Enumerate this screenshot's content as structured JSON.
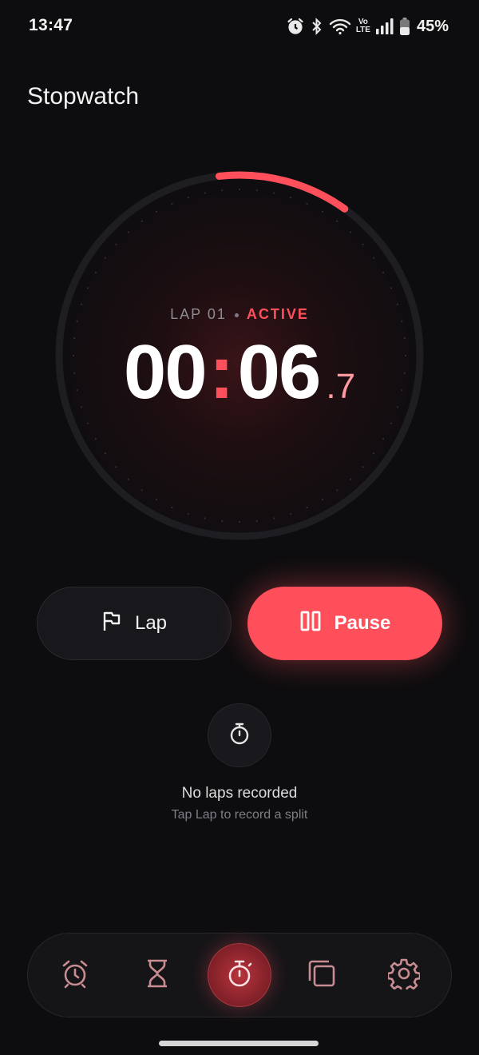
{
  "status_bar": {
    "time": "13:47",
    "volte_top": "Vo",
    "volte_bottom": "LTE",
    "battery_percent": "45%",
    "icons": [
      "alarm-icon",
      "bluetooth-icon",
      "wifi-icon",
      "volte-icon",
      "signal-icon",
      "battery-icon"
    ]
  },
  "header": {
    "title": "Stopwatch"
  },
  "stopwatch": {
    "lap_label": "LAP 01",
    "state_label": "ACTIVE",
    "minutes": "00",
    "separator": ":",
    "seconds": "06",
    "tenths": ".7",
    "progress_fraction": 0.117
  },
  "actions": {
    "lap_label": "Lap",
    "pause_label": "Pause"
  },
  "laps": {
    "empty_title": "No laps recorded",
    "empty_subtitle": "Tap Lap to record a split"
  },
  "bottom_nav": {
    "items": [
      {
        "id": "alarm",
        "icon": "alarm-clock-icon",
        "active": false
      },
      {
        "id": "timer",
        "icon": "hourglass-icon",
        "active": false
      },
      {
        "id": "stopwatch",
        "icon": "stopwatch-icon",
        "active": true
      },
      {
        "id": "world-clock",
        "icon": "stacked-squares-icon",
        "active": false
      },
      {
        "id": "settings",
        "icon": "gear-icon",
        "active": false
      }
    ]
  },
  "colors": {
    "background": "#0d0d0f",
    "accent": "#ff4f5a",
    "surface": "#18181c",
    "muted_text": "#8c8c92"
  }
}
